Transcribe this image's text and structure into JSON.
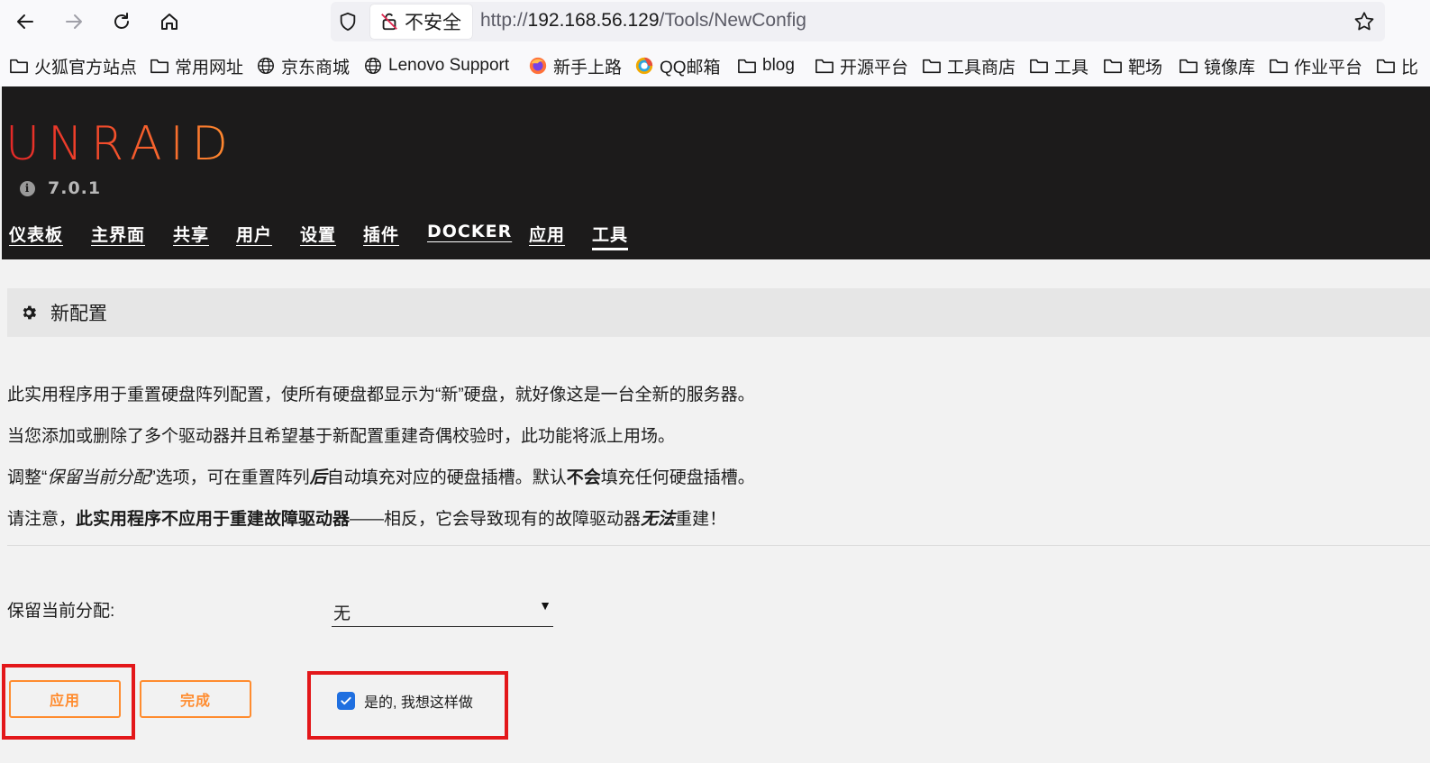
{
  "browser": {
    "insecure_label": "不安全",
    "url_prefix": "http://",
    "url_host": "192.168.56.129",
    "url_path": "/Tools/NewConfig"
  },
  "bookmarks": [
    {
      "label": "火狐官方站点",
      "icon": "folder-icon"
    },
    {
      "label": "常用网址",
      "icon": "folder-icon"
    },
    {
      "label": "京东商城",
      "icon": "globe-icon"
    },
    {
      "label": "Lenovo Support",
      "icon": "globe-icon"
    },
    {
      "label": "新手上路",
      "icon": "firefox-icon"
    },
    {
      "label": "QQ邮箱",
      "icon": "qq-mail-icon"
    },
    {
      "label": "blog",
      "icon": "folder-icon"
    },
    {
      "label": "开源平台",
      "icon": "folder-icon"
    },
    {
      "label": "工具商店",
      "icon": "folder-icon"
    },
    {
      "label": "工具",
      "icon": "folder-icon"
    },
    {
      "label": "靶场",
      "icon": "folder-icon"
    },
    {
      "label": "镜像库",
      "icon": "folder-icon"
    },
    {
      "label": "作业平台",
      "icon": "folder-icon"
    },
    {
      "label": "比",
      "icon": "folder-icon"
    }
  ],
  "header": {
    "logo": "UNRAID",
    "version": "7.0.1",
    "nav": [
      {
        "label": "仪表板"
      },
      {
        "label": "主界面"
      },
      {
        "label": "共享"
      },
      {
        "label": "用户"
      },
      {
        "label": "设置"
      },
      {
        "label": "插件"
      },
      {
        "label": "DOCKER"
      },
      {
        "label": "应用"
      },
      {
        "label": "工具",
        "active": true
      }
    ]
  },
  "page": {
    "title": "新配置",
    "p1": "此实用程序用于重置硬盘阵列配置，使所有硬盘都显示为“新”硬盘，就好像这是一台全新的服务器。",
    "p2": "当您添加或删除了多个驱动器并且希望基于新配置重建奇偶校验时，此功能将派上用场。",
    "p3": {
      "a": "调整“",
      "b": "保留当前分配",
      "c": "”选项，可在重置阵列",
      "d": "后",
      "e": "自动填充对应的硬盘插槽。默认",
      "f": "不会",
      "g": "填充任何硬盘插槽。"
    },
    "p4": {
      "a": "请注意，",
      "b": "此实用程序不应用于重建故障驱动器",
      "c": "——相反，它会导致现有的故障驱动器",
      "d": "无法",
      "e": "重建！"
    },
    "keep_label": "保留当前分配:",
    "keep_value": "无",
    "apply_label": "应用",
    "done_label": "完成",
    "confirm_label": "是的, 我想这样做",
    "confirm_checked": true
  },
  "colors": {
    "accent": "#ff8c2f",
    "header_bg": "#1c1b1b",
    "highlight_frame": "#e3171a",
    "checkbox": "#1f6fe0"
  }
}
